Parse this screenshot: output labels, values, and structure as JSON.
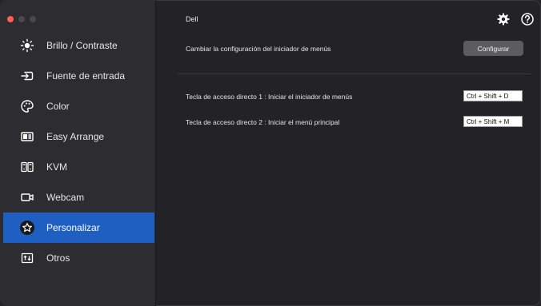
{
  "window": {
    "controls": [
      "close",
      "minimize",
      "zoom"
    ]
  },
  "sidebar": {
    "items": [
      {
        "label": "Brillo / Contraste",
        "icon": "sun-icon",
        "active": false
      },
      {
        "label": "Fuente de entrada",
        "icon": "input-icon",
        "active": false
      },
      {
        "label": "Color",
        "icon": "palette-icon",
        "active": false
      },
      {
        "label": "Easy Arrange",
        "icon": "layout-icon",
        "active": false
      },
      {
        "label": "KVM",
        "icon": "kvm-icon",
        "active": false
      },
      {
        "label": "Webcam",
        "icon": "webcam-icon",
        "active": false
      },
      {
        "label": "Personalizar",
        "icon": "star-icon",
        "active": true
      },
      {
        "label": "Otros",
        "icon": "others-icon",
        "active": false
      }
    ]
  },
  "header": {
    "title": "Dell",
    "icons": [
      "gear-icon",
      "help-icon"
    ]
  },
  "main": {
    "menu_launcher": {
      "label": "Cambiar la configuración del iniciador de menús",
      "button_label": "Configurar"
    },
    "shortcuts": [
      {
        "label": "Tecla de acceso directo 1 : Iniciar el iniciador de menús",
        "value": "Ctrl + Shift + D"
      },
      {
        "label": "Tecla de acceso directo 2 : Iniciar el menú principal",
        "value": "Ctrl + Shift + M"
      }
    ]
  },
  "colors": {
    "accent": "#1f5fc1",
    "sidebar_bg": "#2d2d31",
    "main_bg": "#232327",
    "button_bg": "#5c5c60"
  }
}
